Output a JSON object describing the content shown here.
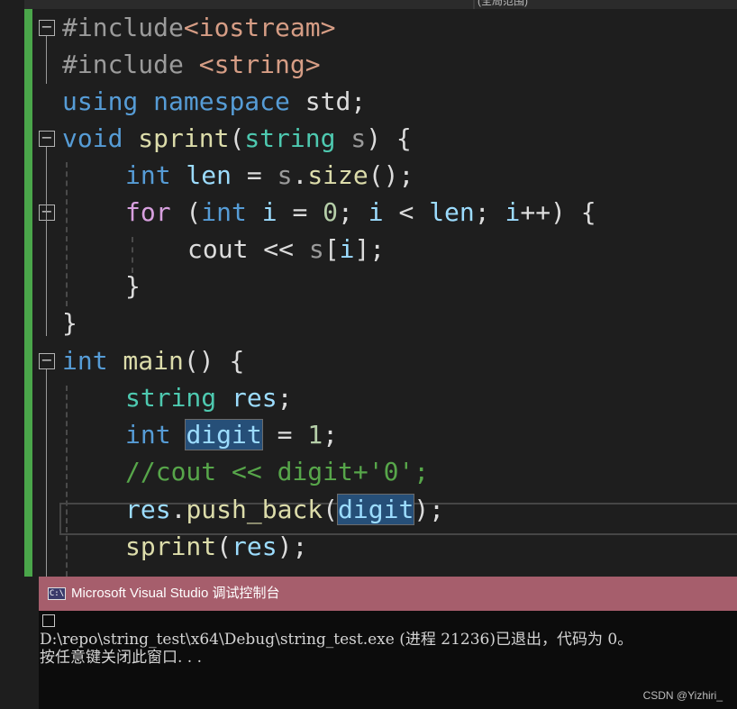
{
  "header": {
    "scope_label": "(全局范围)"
  },
  "code": {
    "l1": {
      "pp": "#include",
      "inc": "<iostream>"
    },
    "l2": {
      "pp": "#include ",
      "inc": "<string>"
    },
    "l3": {
      "kw1": "using",
      "kw2": "namespace",
      "rest": " std;"
    },
    "l4": {
      "kw": "void",
      "fn": "sprint",
      "open": "(",
      "type": "string",
      "param": " s",
      "close": ") {"
    },
    "l5": {
      "kw": "int",
      "var": " len",
      "eq": " = ",
      "obj": "s",
      "dot": ".",
      "fn": "size",
      "end": "();"
    },
    "l6": {
      "kw": "for",
      "p1": " (",
      "kw2": "int",
      "v1": " i",
      "eq": " = ",
      "n": "0",
      "semi": "; ",
      "v2": "i",
      "lt": " < ",
      "v3": "len",
      "semi2": "; ",
      "v4": "i",
      "tail": "++) {"
    },
    "l7": {
      "cout": "cout",
      "op": " << ",
      "obj": "s",
      "br1": "[",
      "idx": "i",
      "br2": "];"
    },
    "l8": {
      "brace": "}"
    },
    "l9": {
      "brace": "}"
    },
    "l10": {
      "kw": "int",
      "fn": " main",
      "rest": "() {"
    },
    "l11": {
      "type": "string",
      "var": " res",
      "semi": ";"
    },
    "l12": {
      "kw": "int",
      "sp": " ",
      "var": "digit",
      "eq": " = ",
      "num": "1",
      "semi": ";"
    },
    "l13": {
      "comment": "//cout << digit+'0';"
    },
    "l14": {
      "var": "res",
      "dot": ".",
      "fn": "push_back",
      "open": "(",
      "arg": "digit",
      "close": ");"
    },
    "l15": {
      "fn": "sprint",
      "open": "(",
      "arg": "res",
      "close": ");"
    }
  },
  "console": {
    "title": "Microsoft Visual Studio 调试控制台",
    "icon_text": "C:\\",
    "line1": "D:\\repo\\string_test\\x64\\Debug\\string_test.exe (进程 21236)已退出，代码为 0。",
    "line2": "按任意键关闭此窗口. . ."
  },
  "watermark": "CSDN @Yizhiri_"
}
